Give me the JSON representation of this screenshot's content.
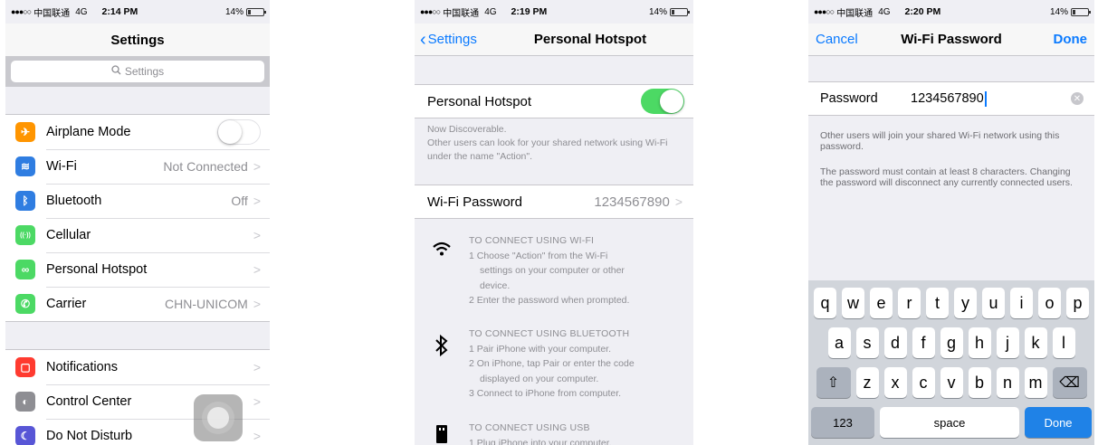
{
  "colors": {
    "accent": "#0a7aff",
    "switch_on": "#4cd964",
    "done_key": "#1f82e7"
  },
  "screen1": {
    "status": {
      "signal": "●●●○○",
      "carrier": "中国联通",
      "network": "4G",
      "time": "2:14 PM",
      "battery": "14%",
      "battery_level": 0.14
    },
    "title": "Settings",
    "search_placeholder": "Settings",
    "group1": [
      {
        "icon": "airplane-icon",
        "glyph": "✈",
        "color": "#ff9500",
        "label": "Airplane Mode",
        "value": "",
        "toggle": "off"
      },
      {
        "icon": "wifi-icon",
        "glyph": "≋",
        "color": "#2f7de1",
        "label": "Wi-Fi",
        "value": "Not Connected",
        "toggle": ""
      },
      {
        "icon": "bluetooth-icon",
        "glyph": "ᛒ",
        "color": "#2f7de1",
        "label": "Bluetooth",
        "value": "Off",
        "toggle": ""
      },
      {
        "icon": "cellular-icon",
        "glyph": "((·))",
        "color": "#4cd964",
        "label": "Cellular",
        "value": "",
        "toggle": ""
      },
      {
        "icon": "hotspot-icon",
        "glyph": "∞",
        "color": "#4cd964",
        "label": "Personal Hotspot",
        "value": "",
        "toggle": ""
      },
      {
        "icon": "phone-icon",
        "glyph": "✆",
        "color": "#4cd964",
        "label": "Carrier",
        "value": "CHN-UNICOM",
        "toggle": ""
      }
    ],
    "group2": [
      {
        "icon": "notifications-icon",
        "glyph": "▢",
        "color": "#ff3b30",
        "label": "Notifications",
        "value": "",
        "toggle": ""
      },
      {
        "icon": "control-center-icon",
        "glyph": "◐",
        "color": "#8e8e93",
        "label": "Control Center",
        "value": "",
        "toggle": ""
      },
      {
        "icon": "moon-icon",
        "glyph": "☾",
        "color": "#5856d6",
        "label": "Do Not Disturb",
        "value": "",
        "toggle": ""
      }
    ]
  },
  "screen2": {
    "status": {
      "signal": "●●●○○",
      "carrier": "中国联通",
      "network": "4G",
      "time": "2:19 PM",
      "battery": "14%",
      "battery_level": 0.14
    },
    "back_label": "Settings",
    "title": "Personal Hotspot",
    "hotspot_label": "Personal Hotspot",
    "hotspot_on": true,
    "discoverable": "Now Discoverable.",
    "discoverable_detail": "Other users can look for your shared network using Wi-Fi under the name \"Action\".",
    "wifi_password_label": "Wi-Fi Password",
    "wifi_password_value": "1234567890",
    "instructions": [
      {
        "icon": "wifi-icon",
        "heading": "TO CONNECT USING WI-FI",
        "lines": [
          "1 Choose \"Action\" from the Wi-Fi",
          "settings on your computer or other",
          "device.",
          "2 Enter the password when prompted."
        ]
      },
      {
        "icon": "bluetooth-icon",
        "heading": "TO CONNECT USING BLUETOOTH",
        "lines": [
          "1 Pair iPhone with your computer.",
          "2 On iPhone, tap Pair or enter the code",
          "displayed on your computer.",
          "3 Connect to iPhone from computer."
        ]
      },
      {
        "icon": "usb-icon",
        "heading": "TO CONNECT USING USB",
        "lines": [
          "1 Plug iPhone into your computer."
        ]
      }
    ]
  },
  "screen3": {
    "status": {
      "signal": "●●●○○",
      "carrier": "中国联通",
      "network": "4G",
      "time": "2:20 PM",
      "battery": "14%",
      "battery_level": 0.14
    },
    "cancel_label": "Cancel",
    "title": "Wi-Fi Password",
    "done_label": "Done",
    "password_label": "Password",
    "password_value": "1234567890",
    "note1": "Other users will join your shared Wi-Fi network using this password.",
    "note2": "The password must contain at least 8 characters. Changing the password will disconnect any currently connected users.",
    "keyboard": {
      "row1": [
        "q",
        "w",
        "e",
        "r",
        "t",
        "y",
        "u",
        "i",
        "o",
        "p"
      ],
      "row2": [
        "a",
        "s",
        "d",
        "f",
        "g",
        "h",
        "j",
        "k",
        "l"
      ],
      "row3": [
        "z",
        "x",
        "c",
        "v",
        "b",
        "n",
        "m"
      ],
      "shift": "⇧",
      "delete": "⌫",
      "numbers": "123",
      "space": "space",
      "done": "Done"
    }
  }
}
